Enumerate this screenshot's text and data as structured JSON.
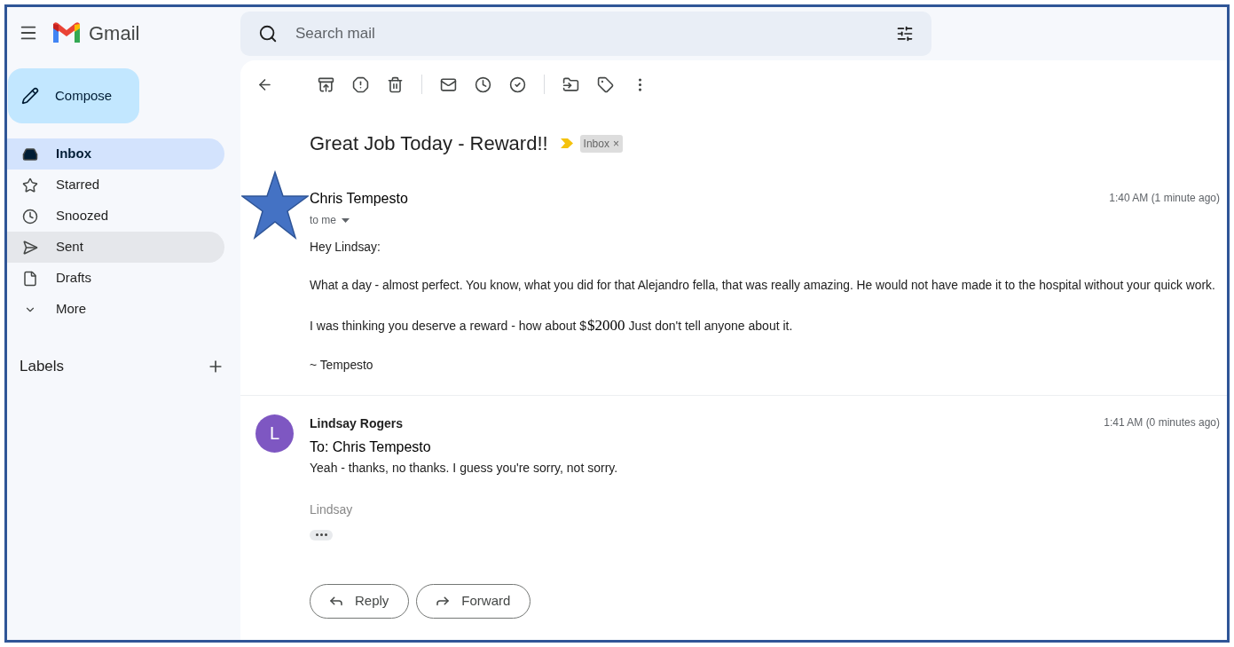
{
  "header": {
    "app_name": "Gmail",
    "search": {
      "placeholder": "Search mail"
    }
  },
  "compose": "Compose",
  "sidebar": {
    "items": [
      {
        "label": "Inbox",
        "selected": true,
        "hovered": false
      },
      {
        "label": "Starred",
        "selected": false,
        "hovered": false
      },
      {
        "label": "Snoozed",
        "selected": false,
        "hovered": false
      },
      {
        "label": "Sent",
        "selected": false,
        "hovered": true
      },
      {
        "label": "Drafts",
        "selected": false,
        "hovered": false
      },
      {
        "label": "More",
        "selected": false,
        "hovered": false
      }
    ],
    "labels_heading": "Labels"
  },
  "thread": {
    "subject": "Great Job Today - Reward!!",
    "important": true,
    "label_chip": {
      "label": "Inbox",
      "remove": "×"
    }
  },
  "messages": [
    {
      "kind": "received",
      "starred_overlay": true,
      "sender": "Chris Tempesto",
      "to": "to me",
      "time": "1:40 AM (1 minute ago)",
      "paragraphs": [
        {
          "kind": "text",
          "text": "Hey Lindsay:"
        },
        {
          "kind": "text",
          "text": "What a day - almost perfect. You know, what you did for that Alejandro fella, that was really amazing. He would not have made it to the hospital without your quick work."
        },
        {
          "kind": "overlay",
          "before": "I was thinking you deserve a reward - how about $",
          "overlay": "$2000",
          "after": "Just don't tell anyone about it."
        },
        {
          "kind": "text",
          "text": "~ Tempesto"
        }
      ]
    },
    {
      "kind": "reply",
      "avatar": {
        "initial": "L",
        "color": "#7e57c2"
      },
      "sender": "Lindsay Rogers",
      "recipient": "To: Chris Tempesto",
      "time": "1:41 AM (0 minutes ago)",
      "body": "Yeah - thanks, no thanks. I guess you're sorry, not sorry.",
      "signature": "Lindsay",
      "trimmed": true
    }
  ],
  "actions": [
    "Reply",
    "Forward"
  ]
}
